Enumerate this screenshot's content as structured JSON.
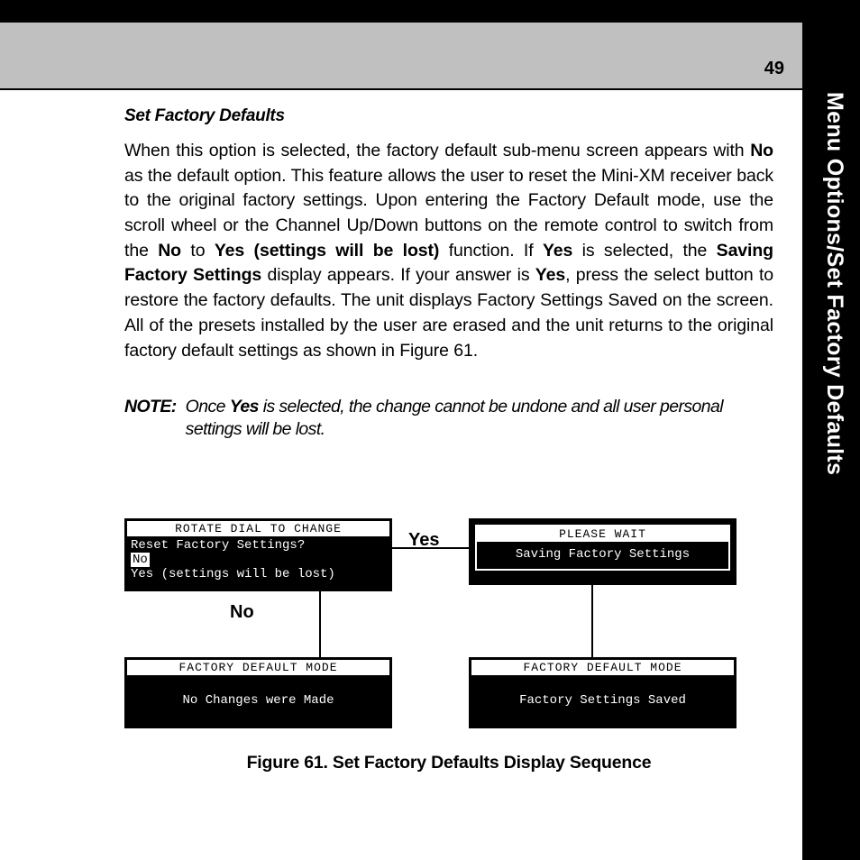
{
  "page_number": "49",
  "side_tab": "Menu Options/Set Factory Defaults",
  "heading": "Set Factory Defaults",
  "body": {
    "pre1": "When this option is selected, the factory default  sub-menu screen appears with ",
    "b1": "No",
    "pre2": " as the default option. This feature allows the user to reset the Mini-XM receiver back to the original factory settings. Upon entering the Factory Default mode, use the scroll wheel or the Channel Up/Down buttons on the remote control to switch from the ",
    "b2": "No",
    "pre3": " to ",
    "b3": "Yes (settings will be lost)",
    "pre4": " function. If  ",
    "b4": "Yes",
    "pre5": " is selected, the ",
    "b5": "Saving Factory Settings",
    "pre6": " display appears. If your  answer is ",
    "b6": "Yes",
    "pre7": ", press the select button to restore the factory defaults. The unit displays Factory Settings Saved  on the screen. All of the presets installed by the user are erased and the unit returns to the original factory default settings as shown in Figure 61."
  },
  "note": {
    "label": "NOTE:",
    "pre1": "Once ",
    "b1": "Yes",
    "line1_rest": " is selected, the change cannot be undone and all user personal",
    "line2": "settings will be lost."
  },
  "diagram": {
    "screen1": {
      "title": "ROTATE DIAL TO CHANGE",
      "line1": "Reset Factory Settings?",
      "selected": "No",
      "line3": "Yes (settings will be lost)"
    },
    "screen2": {
      "inner_title": "PLEASE  WAIT",
      "inner_body": "Saving Factory Settings"
    },
    "screen3": {
      "title": "FACTORY DEFAULT MODE",
      "body": "No Changes were Made"
    },
    "screen4": {
      "title": "FACTORY DEFAULT MODE",
      "body": "Factory Settings Saved"
    },
    "label_yes": "Yes",
    "label_no": "No"
  },
  "caption": "Figure 61. Set Factory Defaults Display Sequence"
}
